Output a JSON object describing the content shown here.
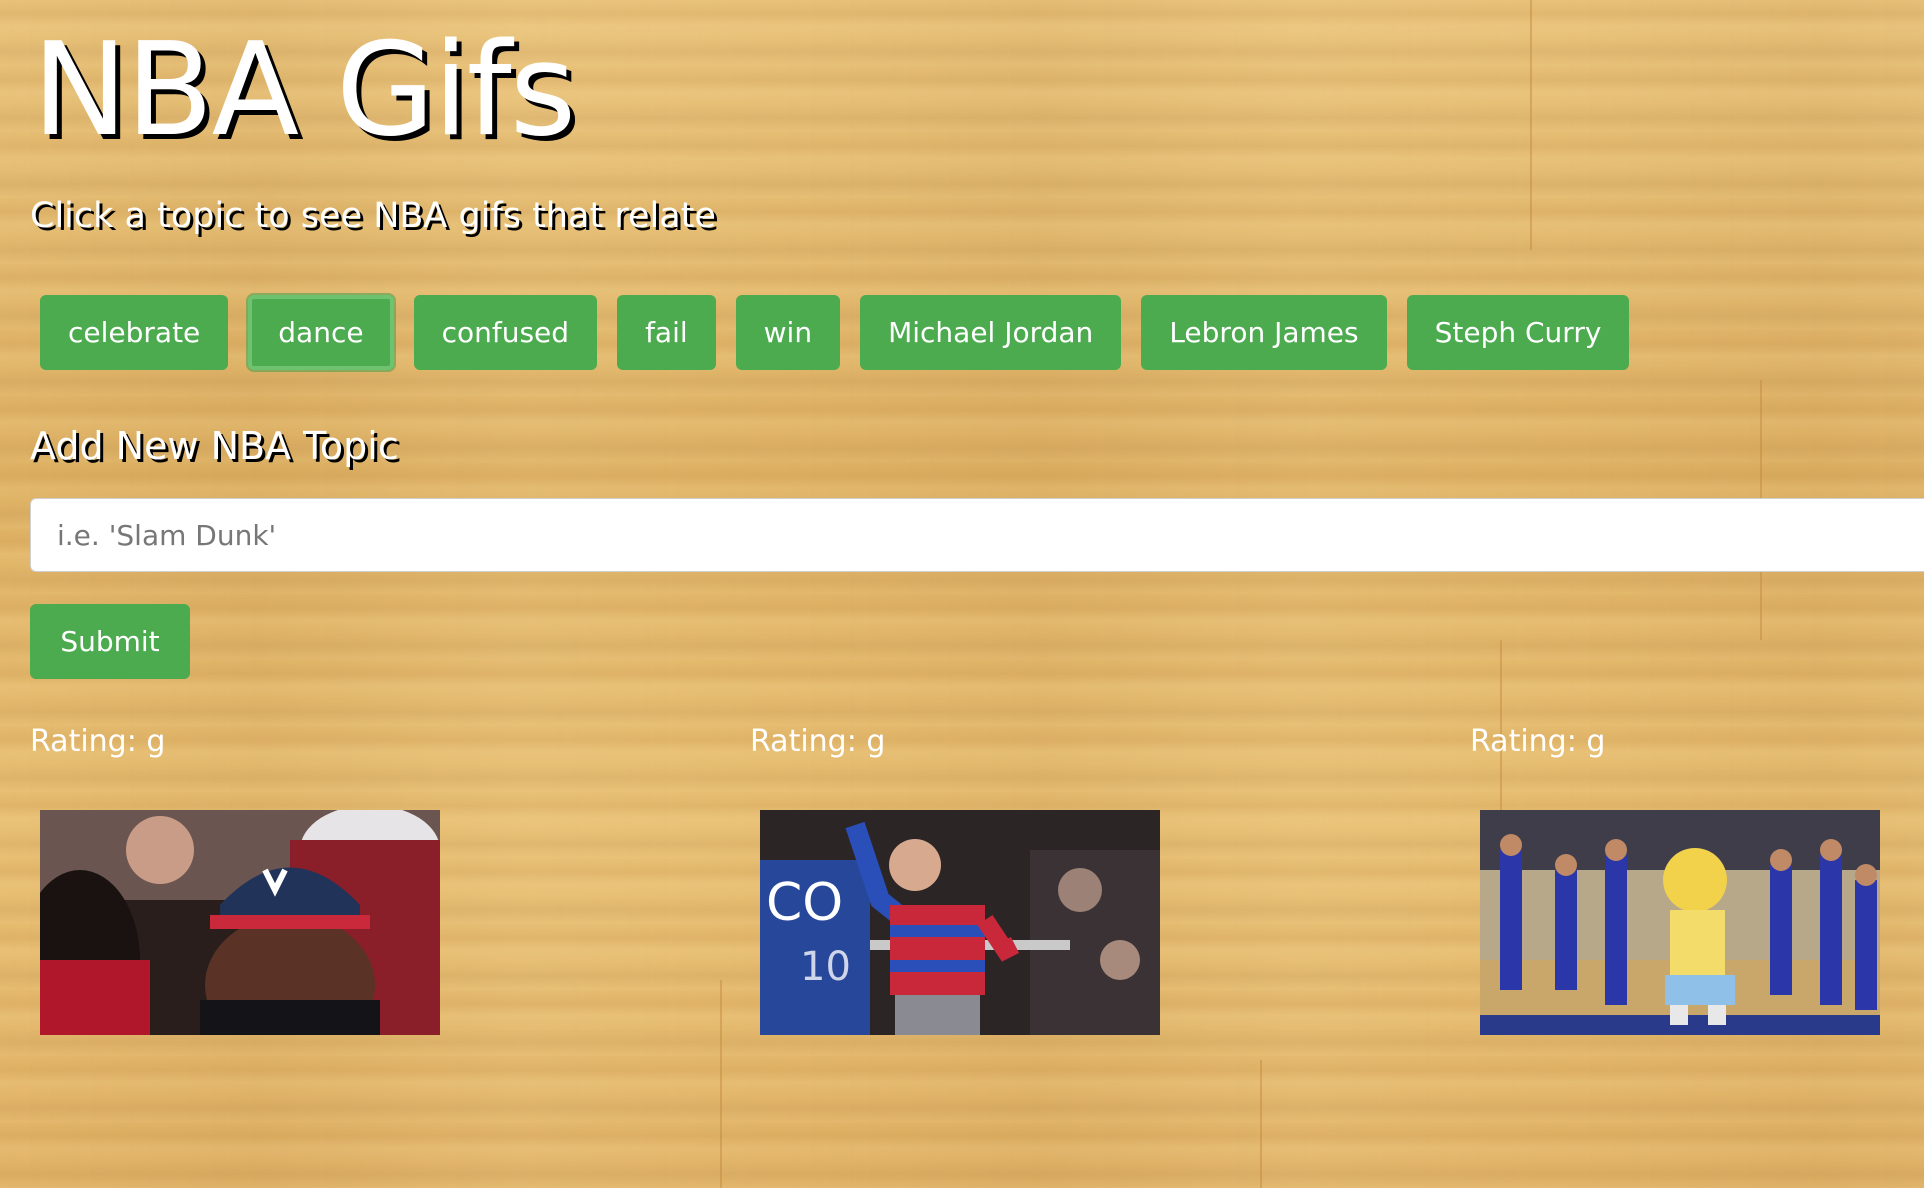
{
  "page": {
    "title": "NBA Gifs",
    "subtitle": "Click a topic to see NBA gifs that relate"
  },
  "topics": [
    {
      "label": "celebrate",
      "active": false
    },
    {
      "label": "dance",
      "active": true
    },
    {
      "label": "confused",
      "active": false
    },
    {
      "label": "fail",
      "active": false
    },
    {
      "label": "win",
      "active": false
    },
    {
      "label": "Michael Jordan",
      "active": false
    },
    {
      "label": "Lebron James",
      "active": false
    },
    {
      "label": "Steph Curry",
      "active": false
    }
  ],
  "add_topic": {
    "label": "Add New NBA Topic",
    "placeholder": "i.e. 'Slam Dunk'",
    "value": "",
    "submit_label": "Submit"
  },
  "gifs": [
    {
      "rating": "Rating: g",
      "image": "fan-cap-gif"
    },
    {
      "rating": "Rating: g",
      "image": "sweater-fan-dancing-gif"
    },
    {
      "rating": "Rating: g",
      "image": "mascot-dancers-gif"
    }
  ],
  "colors": {
    "button_green": "#4cab4f",
    "court_wood": "#e2b565",
    "title_text": "#ffffff",
    "title_shadow": "#000000"
  }
}
